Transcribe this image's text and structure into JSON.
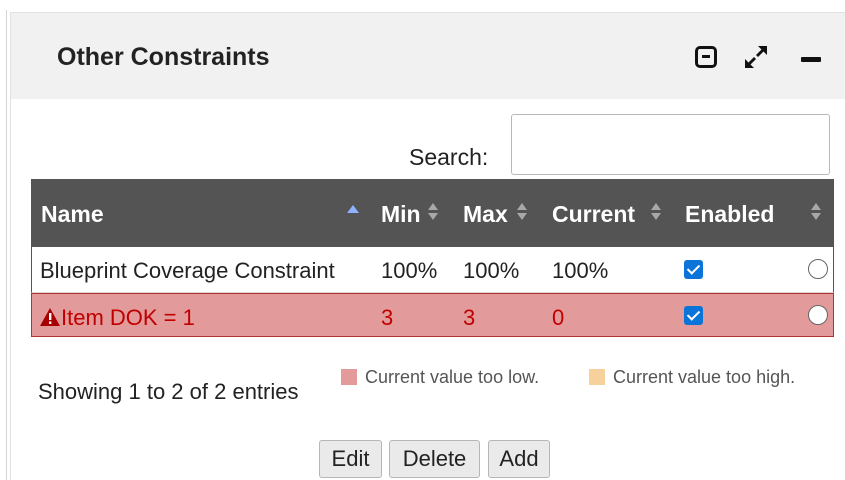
{
  "panel": {
    "title": "Other Constraints",
    "icons": [
      "window-icon",
      "expand-icon",
      "minimize-icon"
    ]
  },
  "search": {
    "label": "Search:",
    "value": "",
    "placeholder": ""
  },
  "table": {
    "columns": [
      "Name",
      "Min",
      "Max",
      "Current",
      "Enabled"
    ],
    "sort": {
      "column": "Name",
      "direction": "ascending"
    },
    "rows": [
      {
        "name": "Blueprint Coverage Constraint",
        "min": "100%",
        "max": "100%",
        "current": "100%",
        "enabled": true,
        "selected": false,
        "status": "normal"
      },
      {
        "name": "Item DOK = 1",
        "min": "3",
        "max": "3",
        "current": "0",
        "enabled": true,
        "selected": false,
        "status": "too-low",
        "warning_icon": "warning-icon"
      }
    ]
  },
  "footer": {
    "info": "Showing 1 to 2 of 2 entries",
    "legend": [
      {
        "label": "Current value too low.",
        "color": "#e39a9a"
      },
      {
        "label": "Current value too high.",
        "color": "#f7d19b"
      }
    ]
  },
  "buttons": {
    "edit": "Edit",
    "delete": "Delete",
    "add": "Add"
  },
  "colors": {
    "header_bg": "#545454",
    "too_low": "#e39a9a",
    "too_high": "#f7d19b",
    "checkbox": "#0a74d9",
    "warning_text": "#c00000"
  }
}
